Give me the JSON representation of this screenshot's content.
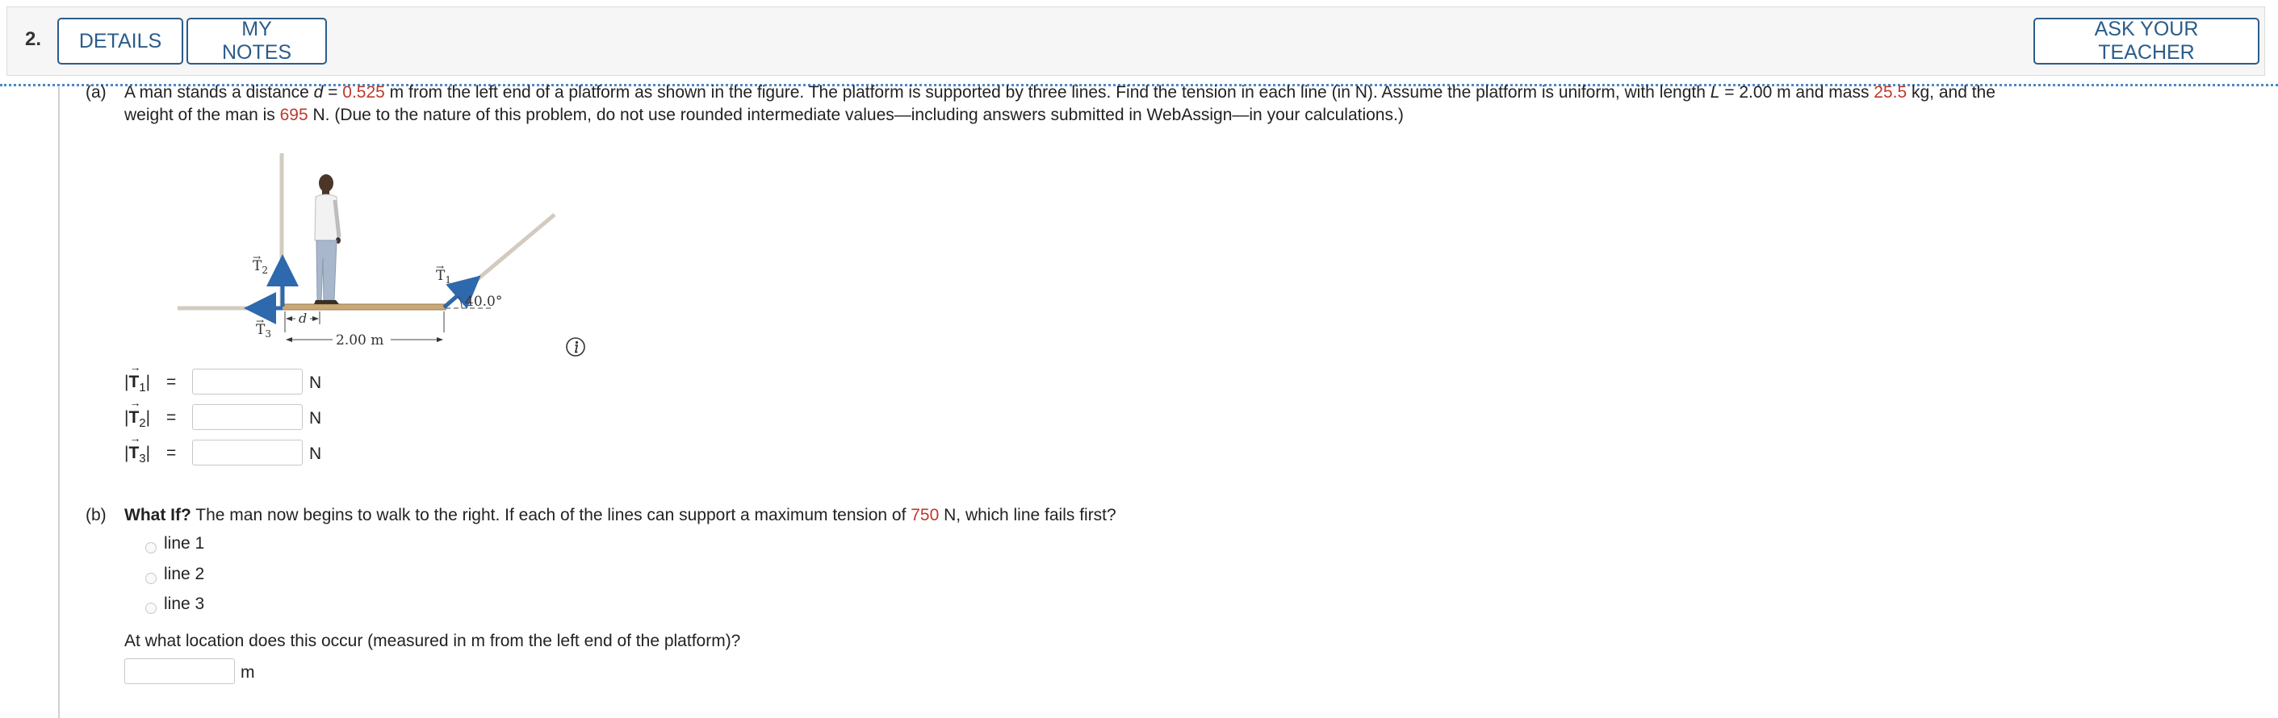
{
  "header": {
    "question_number": "2.",
    "details_label": "DETAILS",
    "notes_label": "MY NOTES",
    "teacher_label": "ASK YOUR TEACHER"
  },
  "part_a": {
    "label": "(a)",
    "t1": "A man stands a distance ",
    "var_d": "d",
    "t2": " = ",
    "d_value": "0.525",
    "t3": " m from the left end of a platform as shown in the figure. The platform is supported by three lines. Find the tension in each line (in N). Assume the platform is uniform, with length ",
    "var_L": "L",
    "t4": " = 2.00 m and mass ",
    "mass_value": "25.5",
    "t5": " kg, and the",
    "t6": "weight of the man is ",
    "weight_value": "695",
    "t7": " N. (Due to the nature of this problem, do not use rounded intermediate values—including answers submitted in WebAssign—in your calculations.)",
    "answers": [
      {
        "vector": "T",
        "sub": "1",
        "eq": "=",
        "unit": "N"
      },
      {
        "vector": "T",
        "sub": "2",
        "eq": "=",
        "unit": "N"
      },
      {
        "vector": "T",
        "sub": "3",
        "eq": "=",
        "unit": "N"
      }
    ]
  },
  "figure": {
    "t2_label": "T",
    "t2_sub": "2",
    "t1_label": "T",
    "t1_sub": "1",
    "t3_label": "T",
    "t3_sub": "3",
    "d_label": "d",
    "length_label": "2.00 m",
    "angle_label": "40.0°",
    "colors": {
      "line": "#d4cbc0",
      "arrow": "#2e68ad",
      "platform": "#c9a877"
    }
  },
  "part_b": {
    "label": "(b)",
    "bold": "What If?",
    "t1": " The man now begins to walk to the right. If each of the lines can support a maximum tension of ",
    "max_tension": "750",
    "t2": " N, which line fails first?",
    "options": [
      "line 1",
      "line 2",
      "line 3"
    ],
    "location_question": "At what location does this occur (measured in m from the left end of the platform)?",
    "location_unit": "m"
  }
}
